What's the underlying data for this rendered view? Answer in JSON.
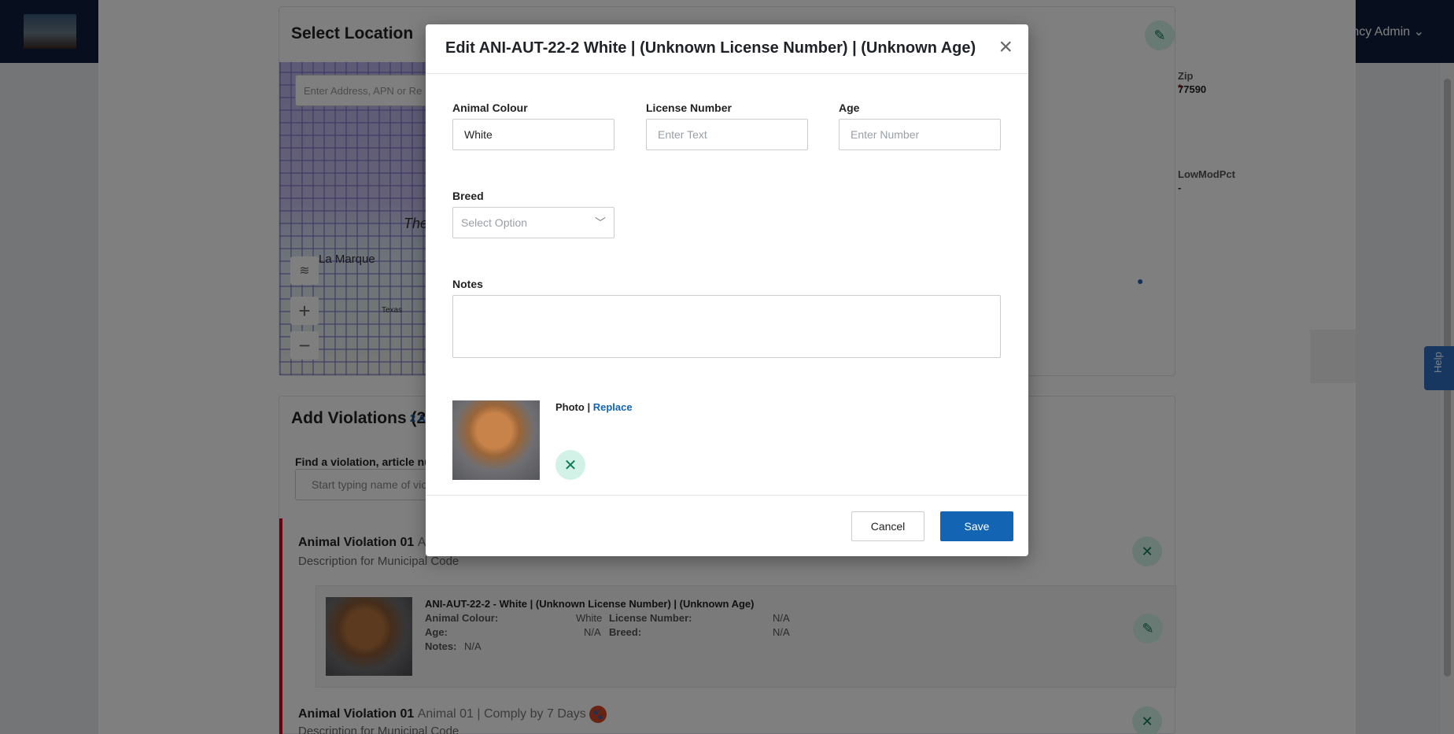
{
  "topbar": {
    "user_menu": "ency Admin ⌄"
  },
  "location": {
    "title": "Select Location",
    "search_placeholder": "Enter Address, APN or Re",
    "map_places": [
      "The",
      "La Marque",
      "Texas"
    ],
    "zip_label": "Zip",
    "zip_value": "77590",
    "lowmod_label": "LowModPct",
    "lowmod_value": "-"
  },
  "violations": {
    "title": "Add Violations (2)",
    "count_link": "2 A",
    "find_label": "Find a violation, article num",
    "find_placeholder": "Start typing name of viol",
    "rows": [
      {
        "title": "Animal Violation 01",
        "sub": "Ani",
        "desc": "Description for Municipal Code"
      },
      {
        "title": "Animal Violation 01",
        "sub": "Animal 01  | Comply by 7 Days",
        "desc": "Description for Municipal Code"
      }
    ],
    "animal": {
      "heading": "ANI-AUT-22-2 - White | (Unknown License Number) | (Unknown Age)",
      "colour_label": "Animal Colour:",
      "colour_value": "White",
      "license_label": "License Number:",
      "license_value": "N/A",
      "age_label": "Age:",
      "age_value": "N/A",
      "breed_label": "Breed:",
      "breed_value": "N/A",
      "notes_label": "Notes:",
      "notes_value": "N/A"
    }
  },
  "help": {
    "label": "Help"
  },
  "modal": {
    "title": "Edit ANI-AUT-22-2 White | (Unknown License Number) | (Unknown Age)",
    "close_icon": "×",
    "colour_label": "Animal Colour",
    "colour_value": "White",
    "license_label": "License Number",
    "license_placeholder": "Enter Text",
    "age_label": "Age",
    "age_placeholder": "Enter Number",
    "breed_label": "Breed",
    "breed_placeholder": "Select Option",
    "notes_label": "Notes",
    "photo_label": "Photo",
    "photo_replace": "Replace",
    "cancel_label": "Cancel",
    "save_label": "Save"
  },
  "colors": {
    "primary": "#1464b4",
    "danger": "#d0021b",
    "success_bg": "#d3f2e7",
    "navbar": "#0f1f3c"
  }
}
